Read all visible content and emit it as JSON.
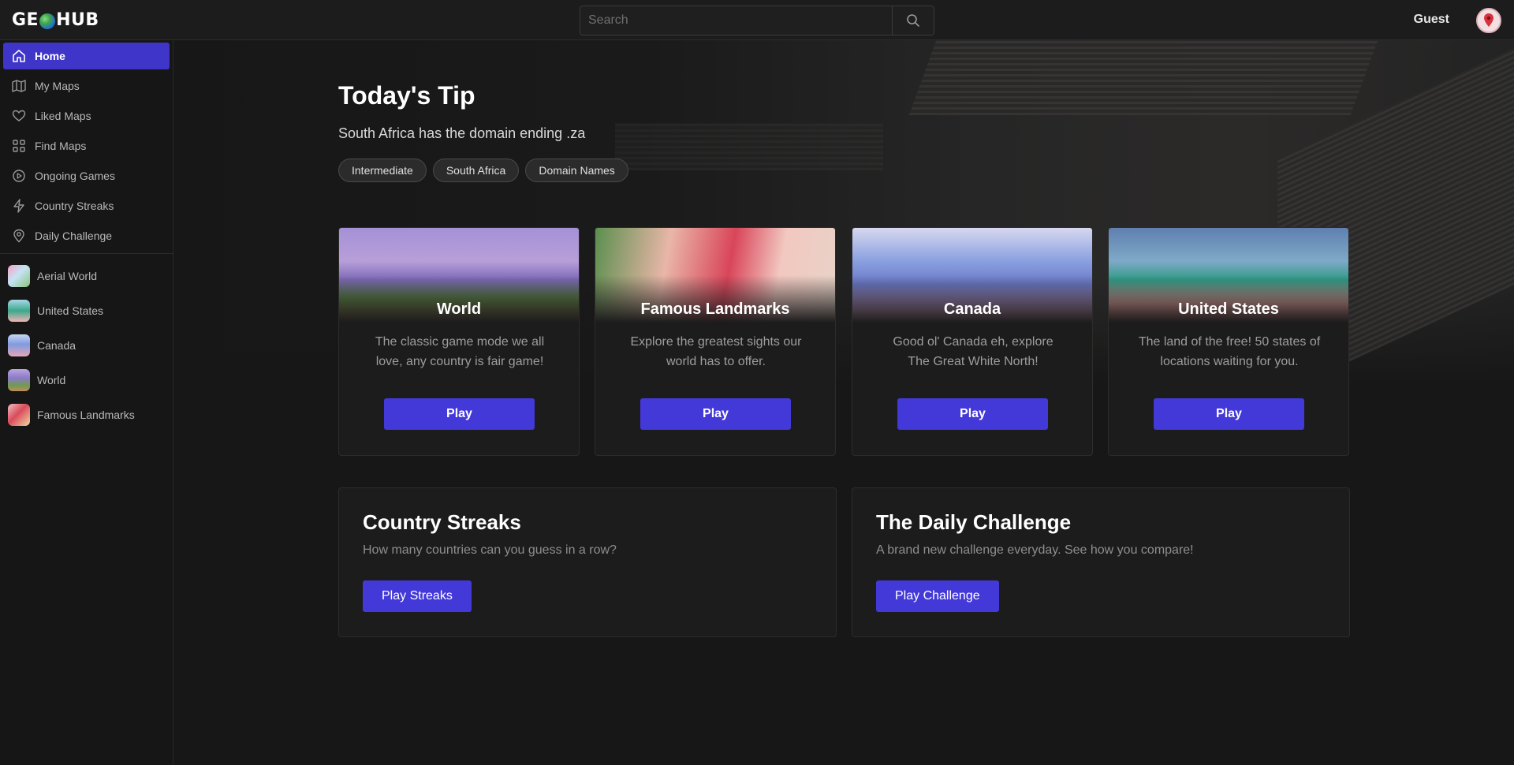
{
  "header": {
    "logo_left": "GE",
    "logo_right": "HUB",
    "search_placeholder": "Search",
    "user_name": "Guest"
  },
  "sidebar": {
    "nav": [
      {
        "label": "Home",
        "icon": "home-icon",
        "active": true
      },
      {
        "label": "My Maps",
        "icon": "map-icon"
      },
      {
        "label": "Liked Maps",
        "icon": "heart-icon"
      },
      {
        "label": "Find Maps",
        "icon": "grid-icon"
      },
      {
        "label": "Ongoing Games",
        "icon": "play-circle-icon"
      },
      {
        "label": "Country Streaks",
        "icon": "lightning-icon"
      },
      {
        "label": "Daily Challenge",
        "icon": "location-pin-icon"
      }
    ],
    "maps": [
      {
        "label": "Aerial World"
      },
      {
        "label": "United States"
      },
      {
        "label": "Canada"
      },
      {
        "label": "World"
      },
      {
        "label": "Famous Landmarks"
      }
    ]
  },
  "tip": {
    "title": "Today's Tip",
    "text": "South Africa has the domain ending .za",
    "tags": [
      "Intermediate",
      "South Africa",
      "Domain Names"
    ]
  },
  "cards": [
    {
      "title": "World",
      "description": "The classic game mode we all love, any country is fair game!",
      "button": "Play"
    },
    {
      "title": "Famous Landmarks",
      "description": "Explore the greatest sights our world has to offer.",
      "button": "Play"
    },
    {
      "title": "Canada",
      "description": "Good ol' Canada eh, explore The Great White North!",
      "button": "Play"
    },
    {
      "title": "United States",
      "description": "The land of the free! 50 states of locations waiting for you.",
      "button": "Play"
    }
  ],
  "panels": [
    {
      "title": "Country Streaks",
      "description": "How many countries can you guess in a row?",
      "button": "Play Streaks"
    },
    {
      "title": "The Daily Challenge",
      "description": "A brand new challenge everyday. See how you compare!",
      "button": "Play Challenge"
    }
  ],
  "colors": {
    "accent": "#4338d8",
    "active_nav": "#3f35c8",
    "background": "#171717",
    "card": "#1c1c1c"
  }
}
